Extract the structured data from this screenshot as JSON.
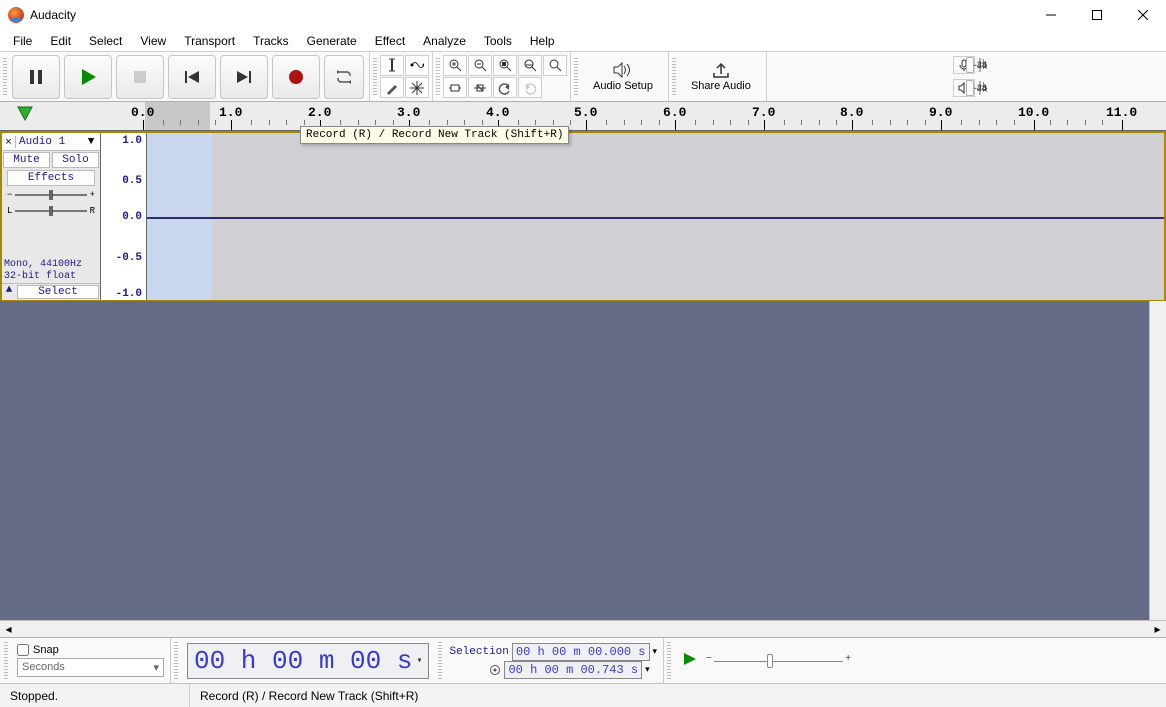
{
  "window": {
    "title": "Audacity"
  },
  "menu": [
    "File",
    "Edit",
    "Select",
    "View",
    "Transport",
    "Tracks",
    "Generate",
    "Effect",
    "Analyze",
    "Tools",
    "Help"
  ],
  "toolbar": {
    "audio_setup": "Audio Setup",
    "share_audio": "Share Audio"
  },
  "meter": {
    "ticks": [
      "-48",
      "-24"
    ]
  },
  "timeline": {
    "labels": [
      "0.0",
      "1.0",
      "2.0",
      "3.0",
      "4.0",
      "5.0",
      "6.0",
      "7.0",
      "8.0",
      "9.0",
      "10.0",
      "11.0"
    ]
  },
  "tooltip": "Record (R) / Record New Track (Shift+R)",
  "track": {
    "name": "Audio 1",
    "mute": "Mute",
    "solo": "Solo",
    "effects": "Effects",
    "info1": "Mono, 44100Hz",
    "info2": "32-bit float",
    "select": "Select",
    "amp_labels": [
      "1.0",
      "0.5",
      "0.0",
      "-0.5",
      "-1.0"
    ]
  },
  "snap": {
    "label": "Snap",
    "units": "Seconds"
  },
  "time_main": "00 h 00 m 00 s",
  "selection": {
    "label": "Selection",
    "start": "00 h 00 m 00.000 s",
    "end": "00 h 00 m 00.743 s"
  },
  "status": {
    "state": "Stopped.",
    "hint": "Record (R) / Record New Track (Shift+R)"
  }
}
